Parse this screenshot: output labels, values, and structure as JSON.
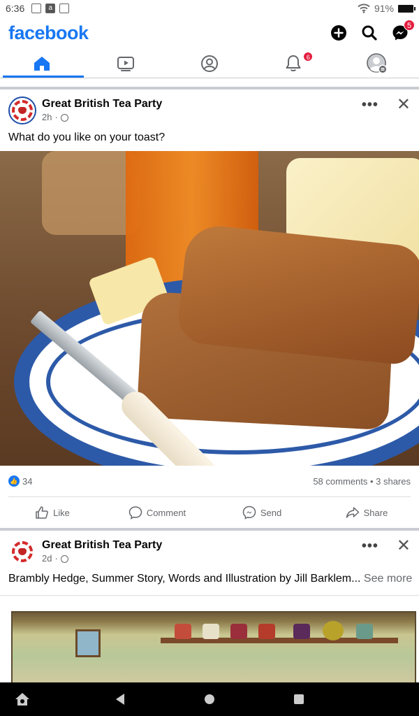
{
  "status_bar": {
    "time": "6:36",
    "battery": "91%"
  },
  "header": {
    "logo": "facebook",
    "messenger_badge": "5"
  },
  "tabs": {
    "notifications_badge": "6"
  },
  "posts": [
    {
      "page_name": "Great British Tea Party",
      "time": "2h",
      "text": "What do you like on your toast?",
      "likes": "34",
      "stats": "58 comments • 3 shares",
      "actions": {
        "like": "Like",
        "comment": "Comment",
        "send": "Send",
        "share": "Share"
      }
    },
    {
      "page_name": "Great British Tea Party",
      "time": "2d",
      "text": "Brambly Hedge, Summer Story, Words and Illustration by Jill Barklem...",
      "see_more": "See more"
    }
  ],
  "colors": {
    "brand": "#1877f2",
    "badge": "#e41e3f"
  }
}
